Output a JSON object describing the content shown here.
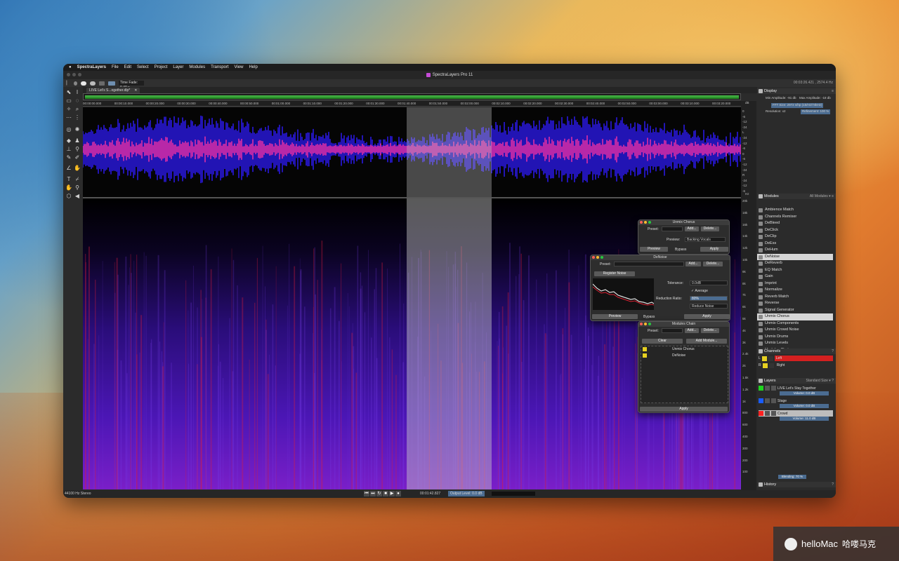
{
  "menubar": {
    "apple": "",
    "app": "SpectraLayers",
    "items": [
      "File",
      "Edit",
      "Select",
      "Project",
      "Layer",
      "Modules",
      "Transport",
      "View",
      "Help"
    ]
  },
  "window": {
    "title": "SpectraLayers Pro 11"
  },
  "toolbar": {
    "time_fade_label": "Time Fade: 0.40 s",
    "readout": "00:03:26.421 , 2574.4 Hz"
  },
  "tab": {
    "label": "LIVE Let's S...ogether.dlp*",
    "close": "✕"
  },
  "ruler": [
    "00:00:00.000",
    "00:00:10.000",
    "00:00:20.000",
    "00:00:30.000",
    "00:00:40.000",
    "00:00:50.000",
    "00:01:00.000",
    "00:01:10.000",
    "00:01:20.000",
    "00:01:30.000",
    "00:01:40.000",
    "00:01:50.000",
    "00:02:00.000",
    "00:02:10.000",
    "00:02:20.000",
    "00:02:30.000",
    "00:02:40.000",
    "00:02:50.000",
    "00:03:00.000",
    "00:03:10.000",
    "00:03:20.000",
    "00:03:30.000"
  ],
  "db_scale": {
    "wave": [
      "0",
      "-6",
      "-12",
      "-24",
      "L",
      "-24",
      "-12",
      "-6",
      "0",
      "-6",
      "-12",
      "-24",
      "R",
      "-24",
      "-12",
      "-6"
    ],
    "spec": [
      "20k",
      "18k",
      "16k",
      "14k",
      "12k",
      "10k",
      "9k",
      "8k",
      "7k",
      "6k",
      "5k",
      "4k",
      "3k",
      "2.4k",
      "2k",
      "1.5k",
      "1.2k",
      "1k",
      "800",
      "600",
      "400",
      "300",
      "200",
      "100"
    ],
    "unit_top": "dB",
    "unit_mid": "Hz"
  },
  "display": {
    "header": "Display",
    "min_amp": "Min Amplitude: -91 db",
    "max_amp": "Max Amplitude: -18 db",
    "fft": "FFT Size: 2972 s/hp (15/Hz/74kHz)",
    "resolution": "Resolution: x2",
    "refinement": "Refinement: 100 %"
  },
  "modules": {
    "header": "Modules",
    "filter": "All Modules",
    "items": [
      "Ambience Match",
      "Channels Remixer",
      "DeBleed",
      "DeClick",
      "DeClip",
      "DeEss",
      "DeHum",
      "DeNoise",
      "DeReverb",
      "EQ Match",
      "Gain",
      "Imprint",
      "Normalize",
      "Reverb Match",
      "Reverse",
      "Signal Generator",
      "Unmix Chorus",
      "Unmix Components",
      "Unmix Crowd Noise",
      "Unmix Drums",
      "Unmix Levels",
      "Modules Chain"
    ],
    "selected": [
      "DeNoise",
      "Unmix Chorus"
    ]
  },
  "channels": {
    "header": "Channels",
    "items": [
      {
        "letter": "L",
        "label": "Left",
        "color": "#d42020"
      },
      {
        "letter": "R",
        "label": "Right",
        "color": "#2a2a2a"
      }
    ]
  },
  "layers": {
    "header": "Layers",
    "size": "Standard Size",
    "project": "LIVE Let's Stay Together",
    "project_vol": "Volume: 0.0 dB",
    "items": [
      {
        "name": "Stage",
        "vol": "Volume: 0.0 dB",
        "color": "#1a5cff"
      },
      {
        "name": "Crowd",
        "vol": "Volume: 11.0 dB",
        "color": "#ff2020"
      }
    ],
    "blending": "Blending: 70 %"
  },
  "history": {
    "header": "History"
  },
  "unmix_chorus": {
    "title": "Unmix Chorus",
    "preset": "Preset:",
    "add": "Add...",
    "delete": "Delete...",
    "preview_label": "Preview:",
    "preview_value": "Backing Vocals",
    "preview_btn": "Preview",
    "bypass": "Bypass",
    "apply": "Apply"
  },
  "denoise": {
    "title": "DeNoise",
    "preset": "Preset:",
    "add": "Add...",
    "delete": "Delete...",
    "register": "Register Noise",
    "tolerance_label": "Tolerance:",
    "tolerance": "0.0dB",
    "average": "Average",
    "ratio_label": "Reduction Ratio:",
    "ratio": "80%",
    "mode": "Reduce Noise",
    "preview_btn": "Preview",
    "bypass": "Bypass",
    "apply": "Apply"
  },
  "chain": {
    "title": "Modules Chain",
    "preset": "Preset:",
    "add": "Add...",
    "delete": "Delete...",
    "clear": "Clear",
    "add_module": "Add Module...",
    "items": [
      "Unmix Chorus",
      "DeNoise"
    ],
    "apply": "Apply"
  },
  "status": {
    "format": "44100 Hz Stereo",
    "time": "00:01:42.827",
    "output": "Output Level: 0.0 dB"
  },
  "watermark": {
    "brand": "helloMac",
    "cn": "哈喽马克"
  },
  "colors": {
    "wave_blue": "#2a18e0",
    "wave_pink": "#e02fb0",
    "spec_purple": "#4b18b0",
    "accent": "#4b6c91"
  }
}
